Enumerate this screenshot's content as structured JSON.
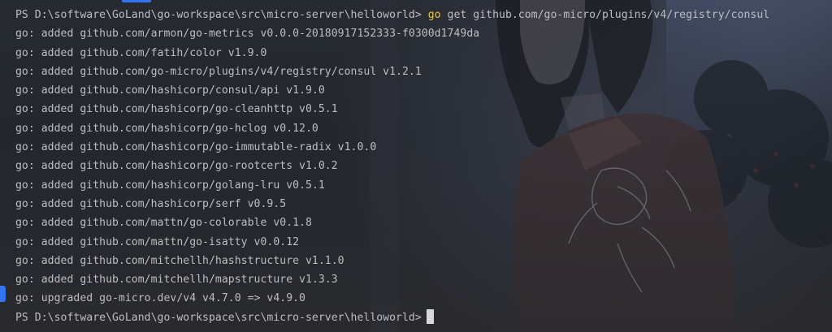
{
  "terminal": {
    "prompt": "PS D:\\software\\GoLand\\go-workspace\\src\\micro-server\\helloworld>",
    "command_keyword": "go",
    "command_rest": "get github.com/go-micro/plugins/v4/registry/consul",
    "output": [
      "go: added github.com/armon/go-metrics v0.0.0-20180917152333-f0300d1749da",
      "go: added github.com/fatih/color v1.9.0",
      "go: added github.com/go-micro/plugins/v4/registry/consul v1.2.1",
      "go: added github.com/hashicorp/consul/api v1.9.0",
      "go: added github.com/hashicorp/go-cleanhttp v0.5.1",
      "go: added github.com/hashicorp/go-hclog v0.12.0",
      "go: added github.com/hashicorp/go-immutable-radix v1.0.0",
      "go: added github.com/hashicorp/go-rootcerts v1.0.2",
      "go: added github.com/hashicorp/golang-lru v0.5.1",
      "go: added github.com/hashicorp/serf v0.9.5",
      "go: added github.com/mattn/go-colorable v0.1.8",
      "go: added github.com/mattn/go-isatty v0.0.12",
      "go: added github.com/mitchellh/hashstructure v1.1.0",
      "go: added github.com/mitchellh/mapstructure v1.3.3",
      "go: upgraded go-micro.dev/v4 v4.7.0 => v4.9.0"
    ],
    "final_prompt": "PS D:\\software\\GoLand\\go-workspace\\src\\micro-server\\helloworld>"
  },
  "colors": {
    "text": "#bcbec4",
    "command_keyword": "#e8c84a",
    "accent": "#3574f0",
    "cursor": "#d6d8dc"
  }
}
